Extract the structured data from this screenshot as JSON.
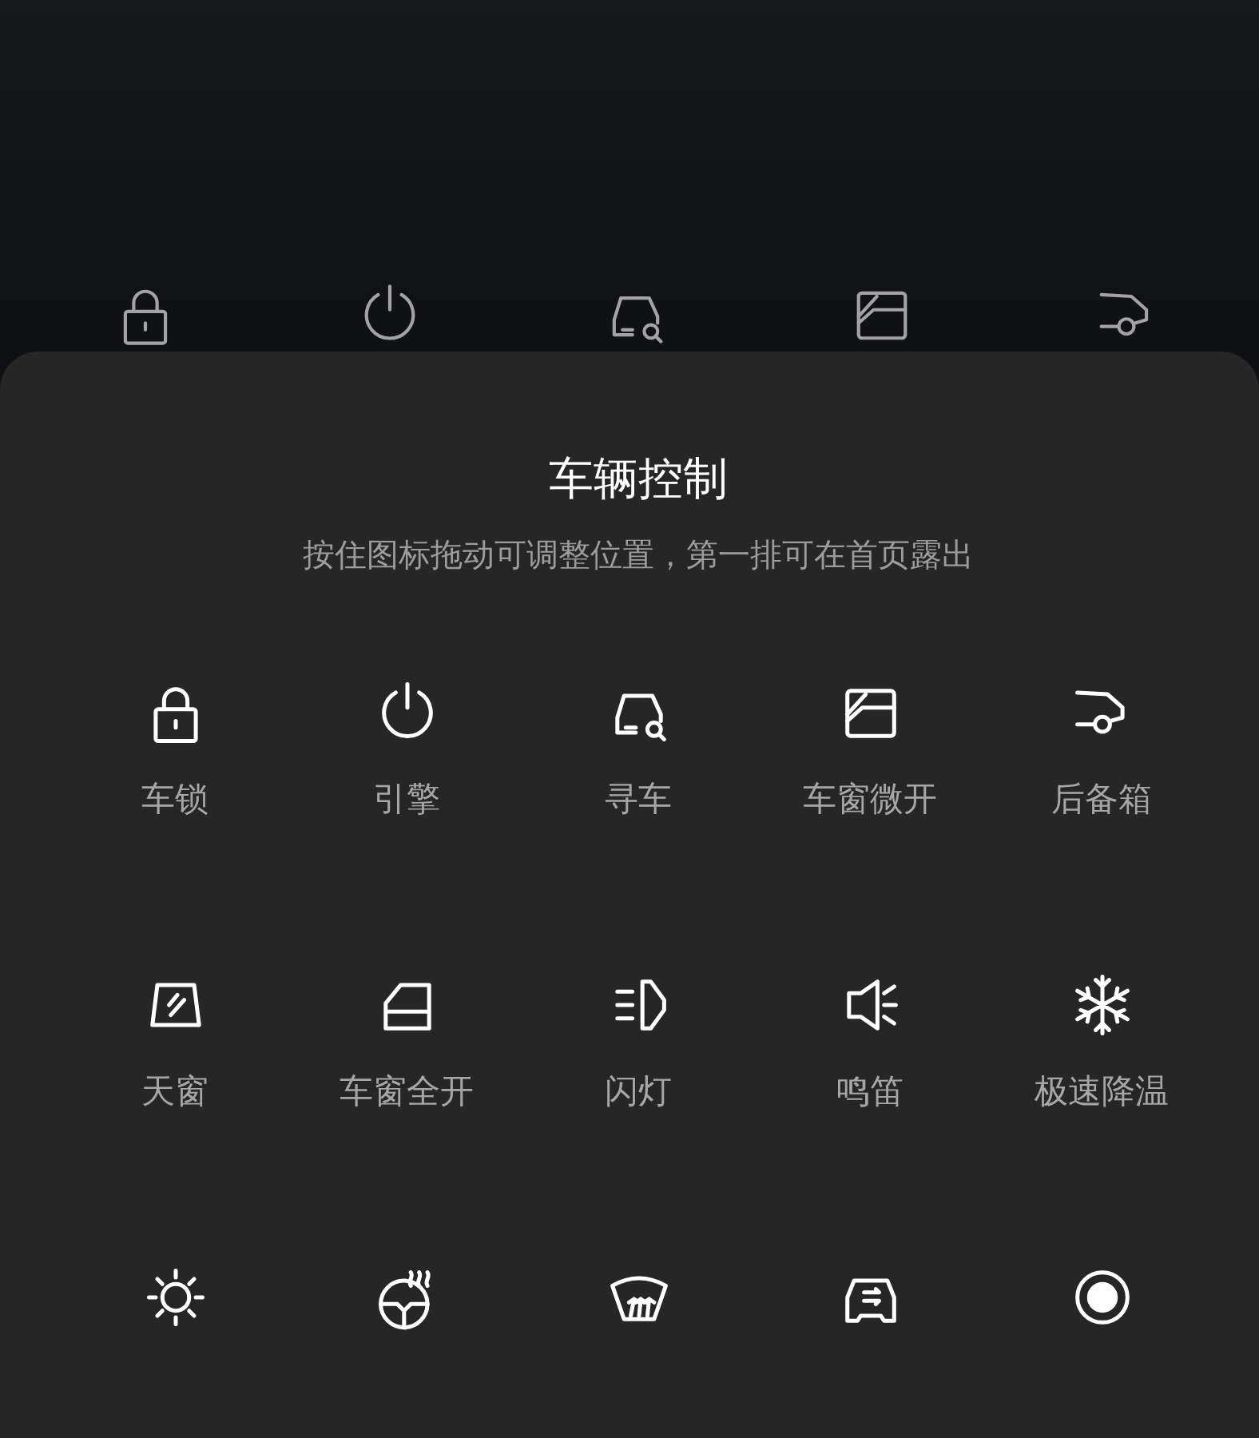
{
  "panel": {
    "title": "车辆控制",
    "subtitle": "按住图标拖动可调整位置，第一排可在首页露出"
  },
  "controls": [
    {
      "kind": "labeled",
      "label": "车锁"
    },
    {
      "kind": "labeled",
      "label": "引擎"
    },
    {
      "kind": "labeled",
      "label": "寻车"
    },
    {
      "kind": "labeled",
      "label": "车窗微开"
    },
    {
      "kind": "labeled",
      "label": "后备箱"
    },
    {
      "kind": "labeled",
      "label": "天窗"
    },
    {
      "kind": "labeled",
      "label": "车窗全开"
    },
    {
      "kind": "labeled",
      "label": "闪灯"
    },
    {
      "kind": "labeled",
      "label": "鸣笛"
    },
    {
      "kind": "labeled",
      "label": "极速降温"
    },
    {
      "kind": "icon_only"
    },
    {
      "kind": "icon_only"
    },
    {
      "kind": "icon_only"
    },
    {
      "kind": "icon_only"
    },
    {
      "kind": "icon_only"
    }
  ]
}
